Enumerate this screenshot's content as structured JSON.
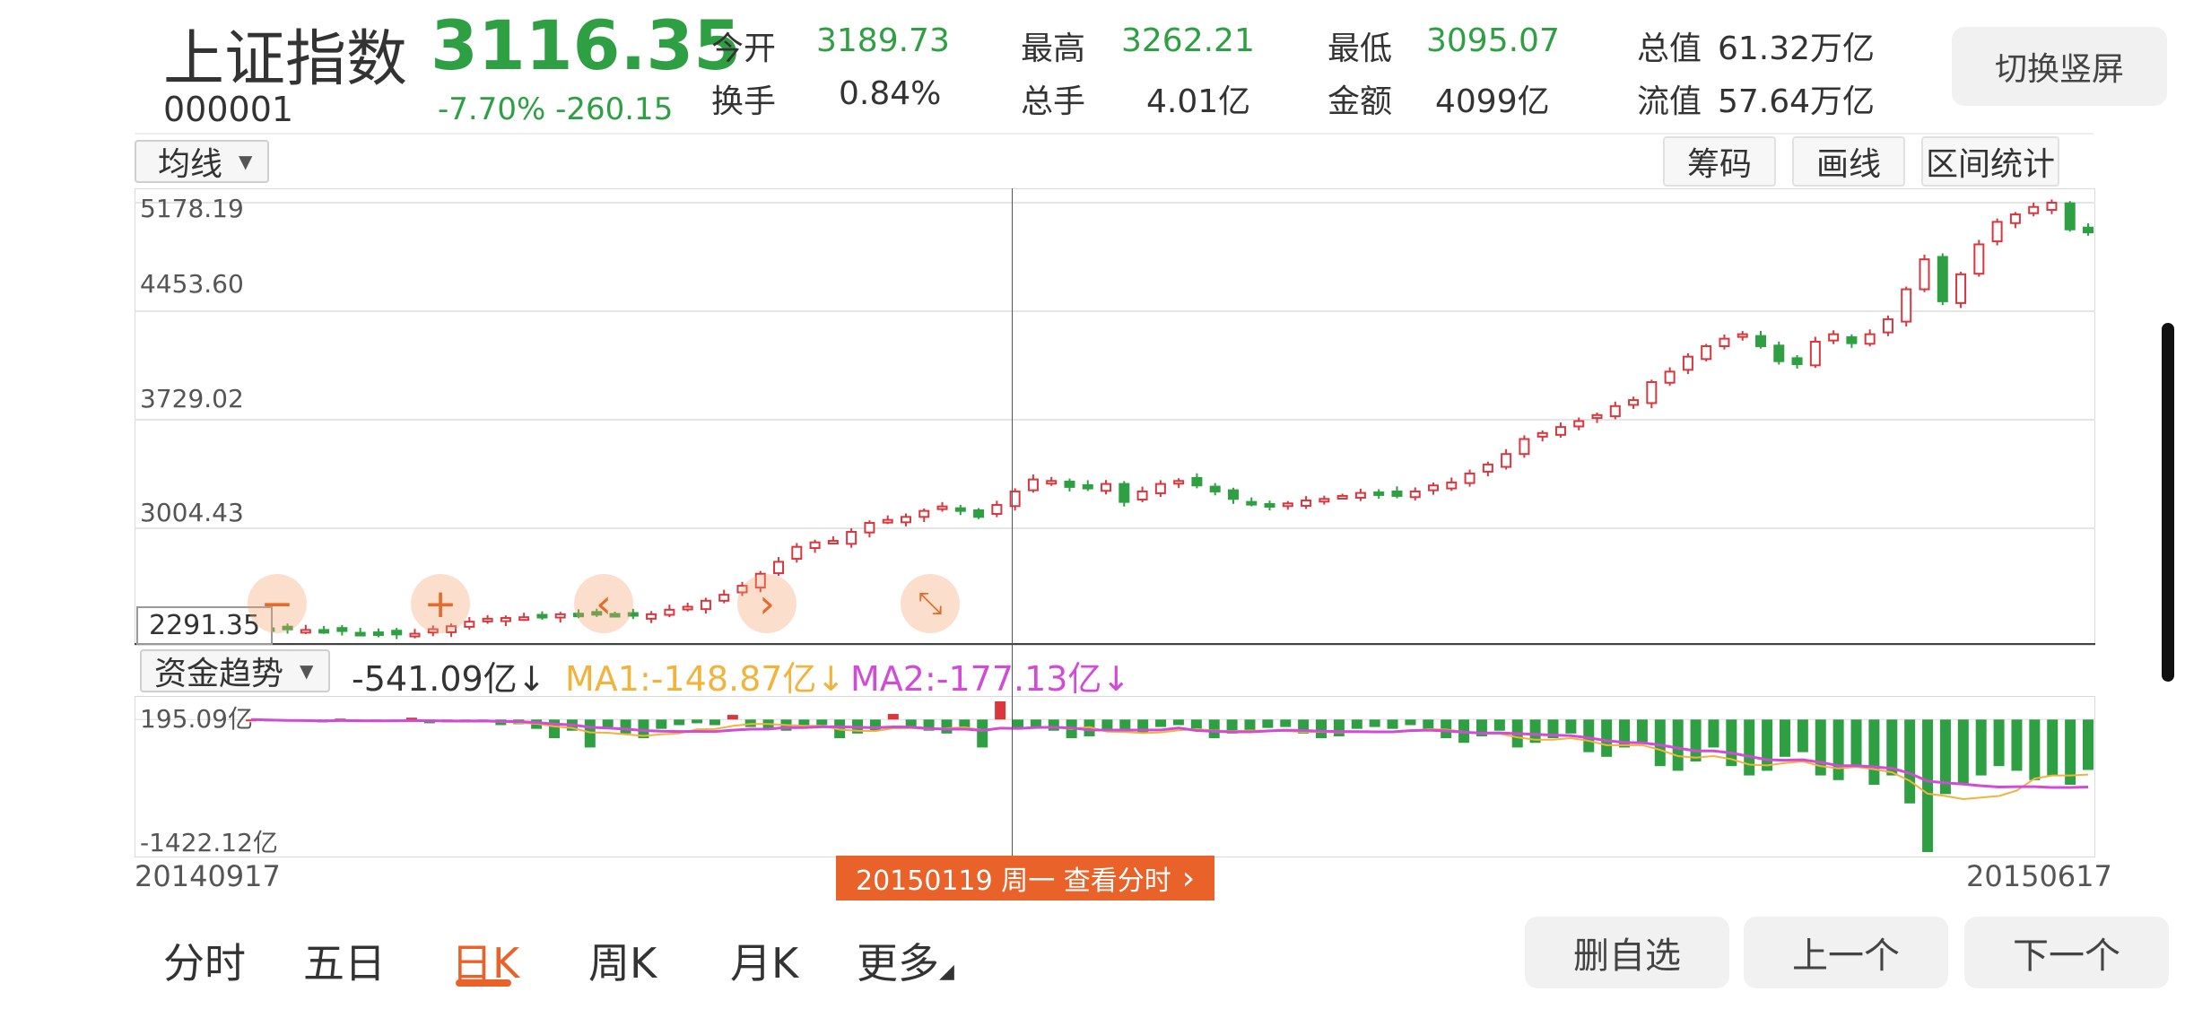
{
  "header": {
    "index_name": "上证指数",
    "code": "000001",
    "price": "3116.35",
    "change": "-7.70% -260.15",
    "stats": [
      {
        "label": "今开",
        "value": "3189.73"
      },
      {
        "label": "最高",
        "value": "3262.21"
      },
      {
        "label": "最低",
        "value": "3095.07"
      },
      {
        "label": "总值",
        "value": "61.32万亿"
      },
      {
        "label": "换手",
        "value": "0.84%"
      },
      {
        "label": "总手",
        "value": "4.01亿"
      },
      {
        "label": "金额",
        "value": "4099亿"
      },
      {
        "label": "流值",
        "value": "57.64万亿"
      }
    ],
    "switch_button": "切换竖屏"
  },
  "toolbar": {
    "ma_select": "均线",
    "buttons": [
      "筹码",
      "画线",
      "区间统计"
    ]
  },
  "kline": {
    "y_labels": [
      "5178.19",
      "4453.60",
      "3729.02",
      "3004.43"
    ],
    "bottom_value": "2291.35",
    "controls": [
      "zoom-out",
      "zoom-in",
      "prev",
      "next",
      "collapse"
    ]
  },
  "fund": {
    "select_label": "资金趋势",
    "value": "-541.09亿↓",
    "ma1": "MA1:-148.87亿↓",
    "ma2": "MA2:-177.13亿↓",
    "y_top": "195.09亿",
    "y_bottom": "-1422.12亿"
  },
  "dates": {
    "start": "20140917",
    "end": "20150617",
    "cursor_tag": "20150119 周一 查看分时"
  },
  "bottom_tabs": [
    {
      "label": "分时",
      "active": false
    },
    {
      "label": "五日",
      "active": false
    },
    {
      "label": "日K",
      "active": true
    },
    {
      "label": "周K",
      "active": false
    },
    {
      "label": "月K",
      "active": false
    },
    {
      "label": "更多",
      "active": false
    }
  ],
  "bottom_buttons": [
    "删自选",
    "上一个",
    "下一个"
  ],
  "colors": {
    "up": "#d9363e",
    "down": "#2ea043",
    "accent": "#e8622a",
    "ma1": "#f2b33d",
    "ma2": "#d24bd6"
  },
  "chart_data": {
    "type": "candlestick",
    "x_range": [
      "20140917",
      "20150617"
    ],
    "y_range": [
      2291.35,
      5178.19
    ],
    "y_ticks": [
      5178.19,
      4453.6,
      3729.02,
      3004.43
    ],
    "close_path": [
      2340,
      2335,
      2330,
      2325,
      2322,
      2318,
      2305,
      2300,
      2295,
      2300,
      2330,
      2350,
      2380,
      2400,
      2405,
      2410,
      2420,
      2430,
      2425,
      2440,
      2430,
      2420,
      2430,
      2460,
      2480,
      2520,
      2560,
      2620,
      2700,
      2780,
      2880,
      2910,
      2920,
      2980,
      3040,
      3060,
      3080,
      3120,
      3150,
      3120,
      3080,
      3160,
      3250,
      3330,
      3320,
      3280,
      3270,
      3300,
      3180,
      3250,
      3300,
      3320,
      3290,
      3250,
      3200,
      3170,
      3150,
      3170,
      3190,
      3200,
      3220,
      3240,
      3230,
      3220,
      3250,
      3290,
      3310,
      3370,
      3430,
      3500,
      3600,
      3640,
      3680,
      3720,
      3760,
      3820,
      3860,
      3980,
      4050,
      4150,
      4220,
      4270,
      4300,
      4220,
      4120,
      4100,
      4250,
      4300,
      4240,
      4300,
      4400,
      4600,
      4800,
      4520,
      4700,
      4900,
      5050,
      5100,
      5150,
      5178,
      5000,
      4980
    ],
    "fund_series": {
      "name": "资金趋势",
      "range": [
        -1422.12,
        195.09
      ],
      "bars": [
        0,
        -10,
        -20,
        -15,
        -30,
        10,
        -25,
        -20,
        -15,
        20,
        -40,
        -30,
        -20,
        -10,
        -60,
        -50,
        -100,
        -200,
        -120,
        -300,
        -80,
        -150,
        -200,
        -100,
        -60,
        -40,
        -60,
        50,
        -80,
        -100,
        -120,
        -90,
        -60,
        -200,
        -150,
        -120,
        60,
        -80,
        -120,
        -150,
        -90,
        -300,
        195,
        -100,
        -80,
        -120,
        -200,
        -180,
        -100,
        -120,
        -150,
        -80,
        -60,
        -100,
        -200,
        -150,
        -120,
        -90,
        -80,
        -150,
        -200,
        -180,
        -100,
        -80,
        -100,
        -60,
        -100,
        -200,
        -250,
        -180,
        -120,
        -300,
        -250,
        -200,
        -150,
        -350,
        -400,
        -300,
        -250,
        -500,
        -550,
        -450,
        -300,
        -500,
        -600,
        -550,
        -400,
        -350,
        -600,
        -650,
        -500,
        -700,
        -600,
        -900,
        -1422,
        -800,
        -700,
        -600,
        -500,
        -550,
        -650,
        -600,
        -700,
        -541
      ],
      "ma1": -148.87,
      "ma2": -177.13
    }
  }
}
